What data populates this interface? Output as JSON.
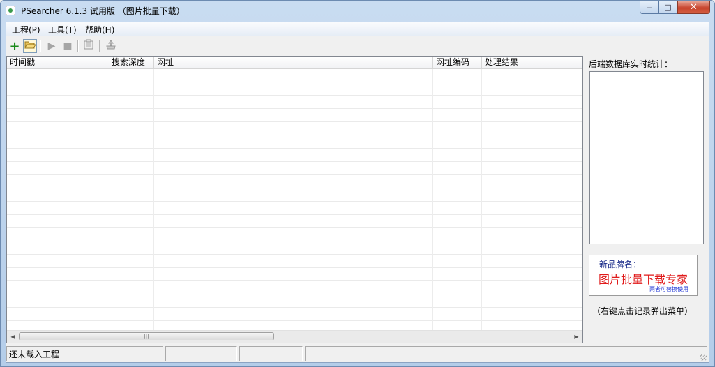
{
  "window": {
    "title": "PSearcher 6.1.3 试用版 （图片批量下载）",
    "controls": {
      "minimize": "▭",
      "maximize": "□",
      "close": "✕"
    }
  },
  "menubar": {
    "items": [
      {
        "label": "工程(P)"
      },
      {
        "label": "工具(T)"
      },
      {
        "label": "帮助(H)"
      }
    ]
  },
  "toolbar": {
    "buttons": [
      {
        "icon": "add-icon",
        "glyph": "+",
        "color": "#1a8a1a",
        "enabled": true
      },
      {
        "icon": "open-folder-icon",
        "glyph": "📂",
        "enabled": true
      },
      {
        "icon": "play-icon",
        "glyph": "▶",
        "enabled": false
      },
      {
        "icon": "stop-icon",
        "glyph": "■",
        "enabled": false
      },
      {
        "icon": "properties-icon",
        "glyph": "▤",
        "enabled": false
      },
      {
        "icon": "export-icon",
        "glyph": "⇪",
        "enabled": false
      }
    ]
  },
  "listview": {
    "columns": [
      "时间戳",
      "搜索深度",
      "网址",
      "网址编码",
      "处理结果"
    ],
    "rows": []
  },
  "stats": {
    "label": "后端数据库实时统计："
  },
  "promo": {
    "heading": "新品牌名：",
    "name": "图片批量下载专家",
    "note": "两者可替换使用"
  },
  "hint": "（右键点击记录弹出菜单）",
  "statusbar": {
    "panes": [
      "还未载入工程",
      "",
      "",
      ""
    ]
  },
  "colors": {
    "promo_heading": "#1b2c8a",
    "promo_name": "#e01a1a",
    "promo_note": "#2a3fd6",
    "close_button": "#c7432c"
  }
}
